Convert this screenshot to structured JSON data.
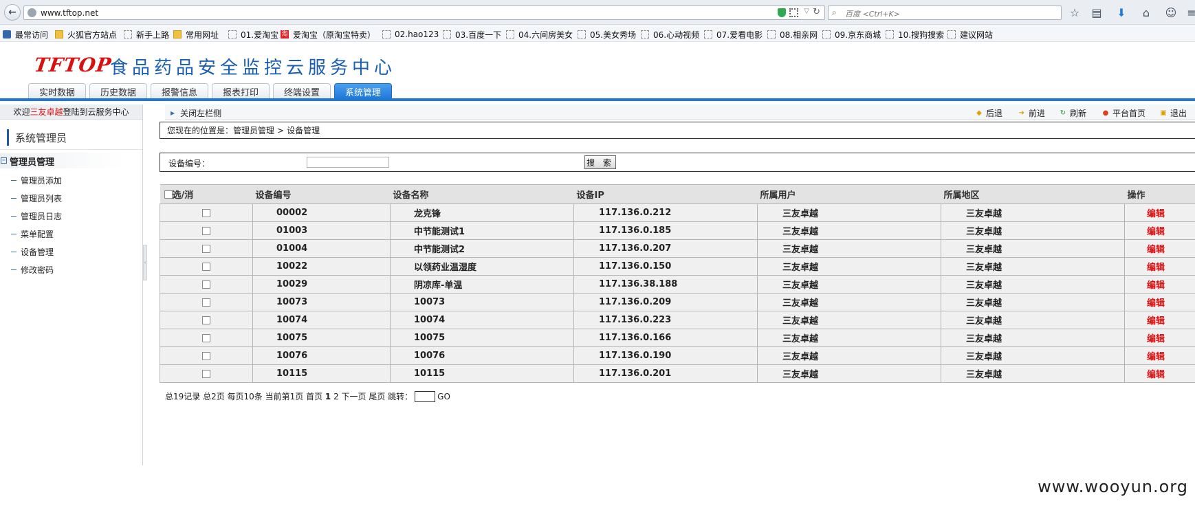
{
  "browser": {
    "url": "www.tftop.net",
    "search_placeholder": "百度 <Ctrl+K>",
    "bookmarks": [
      {
        "label": "最常访问",
        "icon": "blue-icon"
      },
      {
        "label": "火狐官方站点",
        "icon": "folder-icon"
      },
      {
        "label": "新手上路",
        "icon": "page-icon"
      },
      {
        "label": "常用网址",
        "icon": "folder-icon"
      },
      {
        "label": "01.爱淘宝",
        "icon": "page-icon"
      },
      {
        "label": "爱淘宝（原淘宝特卖）",
        "icon": "taobao-icon"
      },
      {
        "label": "02.hao123",
        "icon": "page-icon"
      },
      {
        "label": "03.百度一下",
        "icon": "page-icon"
      },
      {
        "label": "04.六间房美女",
        "icon": "page-icon"
      },
      {
        "label": "05.美女秀场",
        "icon": "page-icon"
      },
      {
        "label": "06.心动视频",
        "icon": "page-icon"
      },
      {
        "label": "07.爱看电影",
        "icon": "page-icon"
      },
      {
        "label": "08.相亲网",
        "icon": "page-icon"
      },
      {
        "label": "09.京东商城",
        "icon": "page-icon"
      },
      {
        "label": "10.搜狗搜索",
        "icon": "page-icon"
      },
      {
        "label": "建议网站",
        "icon": "page-icon"
      }
    ]
  },
  "header": {
    "logo": "TFTOP",
    "title": "食品药品安全监控云服务中心",
    "tabs": [
      "实时数据",
      "历史数据",
      "报警信息",
      "报表打印",
      "终端设置",
      "系统管理"
    ],
    "active_tab": 5,
    "brand_color": "#1f78d8",
    "logo_color": "#d81010"
  },
  "sidebar": {
    "welcome_prefix": "欢迎",
    "username": "三友卓越",
    "welcome_suffix": "登陆到云服务中心",
    "heading": "系统管理员",
    "group": "管理员管理",
    "items": [
      "管理员添加",
      "管理员列表",
      "管理员日志",
      "菜单配置",
      "设备管理",
      "修改密码"
    ]
  },
  "toolbar": {
    "close_left": "关闭左栏侧",
    "back": "后退",
    "forward": "前进",
    "refresh": "刷新",
    "home": "平台首页",
    "logout": "退出"
  },
  "breadcrumb": {
    "prefix": "您现在的位置是：",
    "parent": "管理员管理",
    "sep": ">",
    "current": "设备管理"
  },
  "search": {
    "label": "设备编号：",
    "value": "",
    "button": "搜 索"
  },
  "table": {
    "headers": [
      "选/消",
      "设备编号",
      "设备名称",
      "设备IP",
      "所属用户",
      "所属地区",
      "操作"
    ],
    "rows": [
      {
        "id": "00002",
        "name": "龙克锋",
        "ip": "117.136.0.212",
        "user": "三友卓越",
        "area": "三友卓越",
        "op": "编辑"
      },
      {
        "id": "01003",
        "name": "中节能测试1",
        "ip": "117.136.0.185",
        "user": "三友卓越",
        "area": "三友卓越",
        "op": "编辑"
      },
      {
        "id": "01004",
        "name": "中节能测试2",
        "ip": "117.136.0.207",
        "user": "三友卓越",
        "area": "三友卓越",
        "op": "编辑"
      },
      {
        "id": "10022",
        "name": "以领药业温湿度",
        "ip": "117.136.0.150",
        "user": "三友卓越",
        "area": "三友卓越",
        "op": "编辑"
      },
      {
        "id": "10029",
        "name": "阴凉库-单温",
        "ip": "117.136.38.188",
        "user": "三友卓越",
        "area": "三友卓越",
        "op": "编辑"
      },
      {
        "id": "10073",
        "name": "10073",
        "ip": "117.136.0.209",
        "user": "三友卓越",
        "area": "三友卓越",
        "op": "编辑"
      },
      {
        "id": "10074",
        "name": "10074",
        "ip": "117.136.0.223",
        "user": "三友卓越",
        "area": "三友卓越",
        "op": "编辑"
      },
      {
        "id": "10075",
        "name": "10075",
        "ip": "117.136.0.166",
        "user": "三友卓越",
        "area": "三友卓越",
        "op": "编辑"
      },
      {
        "id": "10076",
        "name": "10076",
        "ip": "117.136.0.190",
        "user": "三友卓越",
        "area": "三友卓越",
        "op": "编辑"
      },
      {
        "id": "10115",
        "name": "10115",
        "ip": "117.136.0.201",
        "user": "三友卓越",
        "area": "三友卓越",
        "op": "编辑"
      }
    ]
  },
  "pager": {
    "summary": "总19记录 总2页 每页10条 当前第1页 首页 ",
    "page1": "1",
    "page2": "2",
    "rest": " 下一页 尾页 跳转：",
    "go": "GO"
  },
  "watermark": "www.wooyun.org"
}
